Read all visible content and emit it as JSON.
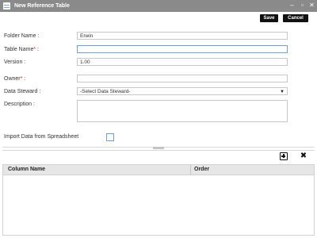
{
  "window": {
    "title": "New Reference Table",
    "controls": {
      "minimize": "–",
      "maximize": "▫",
      "close": "✕"
    }
  },
  "toolbar": {
    "save_label": "Save",
    "cancel_label": "Cancel"
  },
  "form": {
    "folder_name": {
      "label": "Folder Name :",
      "value": "Erwin"
    },
    "table_name": {
      "label": "Table Name",
      "required_mark": "*",
      "suffix": " :",
      "value": ""
    },
    "version": {
      "label": "Version :",
      "value": "1.00"
    },
    "owner": {
      "label": "Owner",
      "required_mark": "*",
      "suffix": " :",
      "value": ""
    },
    "data_steward": {
      "label": "Data Steward :",
      "selected": "-Select Data Steward-"
    },
    "description": {
      "label": "Description :",
      "value": ""
    },
    "import": {
      "label": "Import Data from Spreadsheet",
      "checked": false
    }
  },
  "grid": {
    "columns": [
      "Column Name",
      "Order"
    ],
    "rows": []
  },
  "icons": {
    "add_row": "add-row-icon",
    "delete_row": "delete-row-icon",
    "app": "table-icon"
  }
}
